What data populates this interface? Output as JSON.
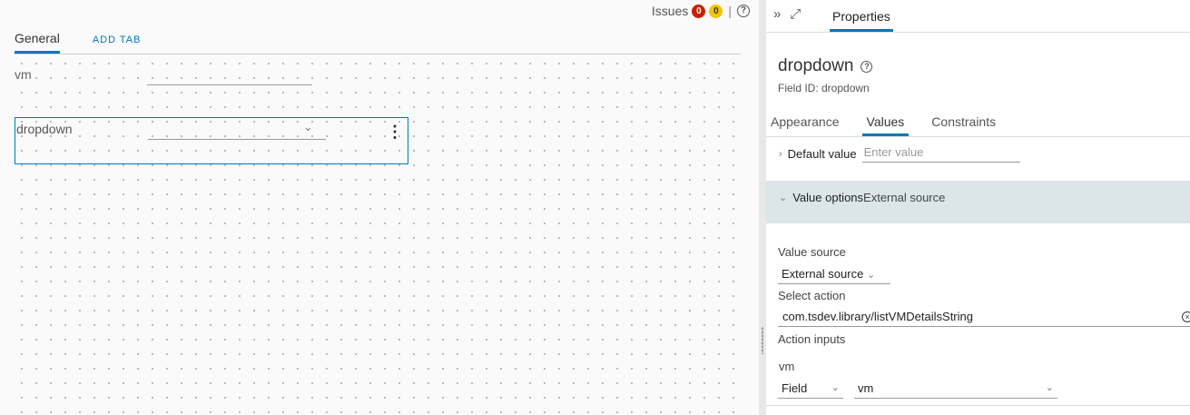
{
  "canvas": {
    "issues_label": "Issues",
    "issues_errors": "0",
    "issues_warnings": "0",
    "separator": "|",
    "help_glyph": "?",
    "tabs": [
      {
        "label": "General",
        "active": true
      }
    ],
    "add_tab_label": "ADD TAB",
    "fields": [
      {
        "label": "vm",
        "type": "text"
      },
      {
        "label": "dropdown",
        "type": "dropdown",
        "selected": true
      }
    ],
    "dropdown_chevron": "⌄",
    "kebab_glyph": "⋮"
  },
  "properties": {
    "collapse_icon": "»",
    "expand_icon": "⤢",
    "panel_tab": "Properties",
    "title": "dropdown",
    "field_id": "Field ID: dropdown",
    "subtabs": [
      {
        "label": "Appearance",
        "active": false
      },
      {
        "label": "Values",
        "active": true
      },
      {
        "label": "Constraints",
        "active": false
      }
    ],
    "default_value": {
      "chevron": "›",
      "label": "Default value",
      "placeholder": "Enter value"
    },
    "value_options": {
      "chevron": "⌄",
      "label": "Value options",
      "summary": "External source",
      "value_source_label": "Value source",
      "value_source_value": "External source",
      "select_action_label": "Select action",
      "select_action_value": "com.tsdev.library/listVMDetailsString",
      "clear_glyph": "×",
      "action_inputs_label": "Action inputs",
      "inputs": [
        {
          "name": "vm",
          "type_value": "Field",
          "field_value": "vm"
        }
      ]
    }
  },
  "colors": {
    "accent": "#0079b8",
    "error_badge": "#c92100",
    "warning_badge": "#f2c500",
    "section_band": "#dbe5ea"
  }
}
